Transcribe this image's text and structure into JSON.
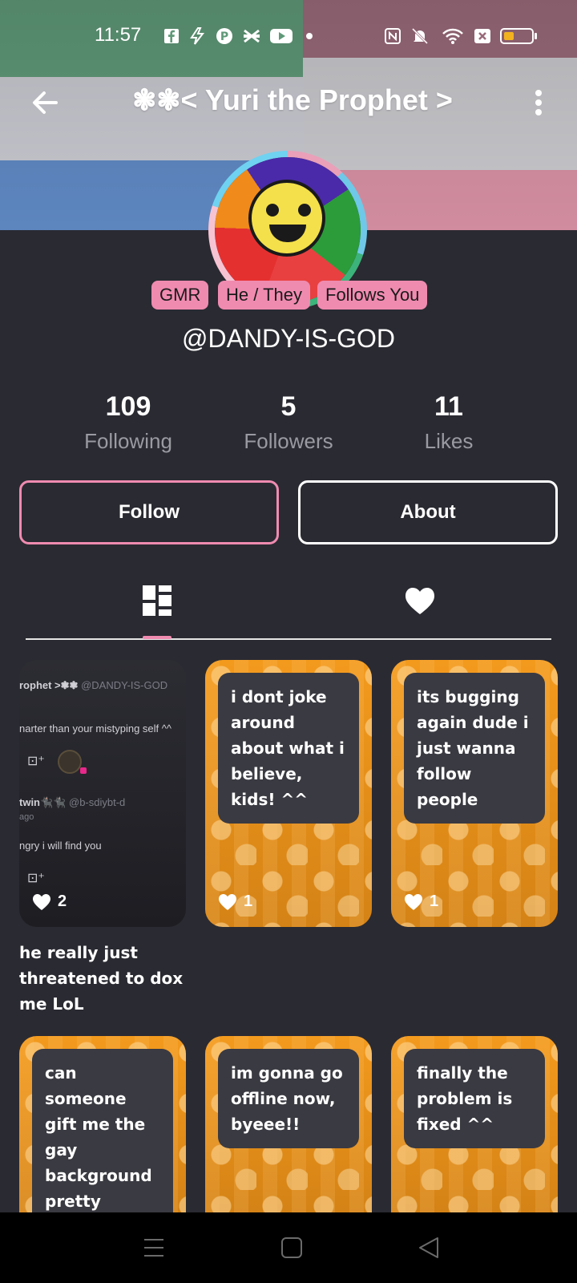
{
  "status_bar": {
    "time": "11:57",
    "battery_level": 0.35,
    "icons": [
      "facebook-icon",
      "bolt-icon",
      "pinterest-icon",
      "capcut-icon",
      "youtube-icon",
      "dot-icon",
      "nfc-icon",
      "mute-icon",
      "wifi-icon",
      "sim-x-icon",
      "battery-icon"
    ]
  },
  "header": {
    "title": "❃❃< Yuri the Prophet >",
    "back_icon": "arrow-left-icon",
    "menu_icon": "more-vert-icon"
  },
  "profile": {
    "badges": [
      "GMR",
      "He / They",
      "Follows You"
    ],
    "handle": "@DANDY-IS-GOD",
    "stats": [
      {
        "value": "109",
        "label": "Following"
      },
      {
        "value": "5",
        "label": "Followers"
      },
      {
        "value": "11",
        "label": "Likes"
      }
    ]
  },
  "actions": {
    "follow_label": "Follow",
    "about_label": "About"
  },
  "tabs": {
    "posts_icon": "grid-icon",
    "likes_icon": "heart-icon",
    "active": "posts"
  },
  "posts": [
    {
      "type": "screenshot",
      "lines": {
        "user": "rophet >❃❃",
        "user_handle": "@DANDY-IS-GOD",
        "msg1": "narter than your mistyping self ^^",
        "user2": "twin🐈‍⬛🐈‍⬛",
        "user2_handle": "@b-sdiybt-d",
        "ago": "ago",
        "msg2": "ngry i will find you"
      },
      "likes": "2",
      "caption": "he really just threatened to dox me LoL"
    },
    {
      "type": "text",
      "text": "i dont joke around about what i believe, kids! ^^",
      "likes": "1"
    },
    {
      "type": "text",
      "text": "its bugging again dude i just wanna follow people",
      "likes": "1"
    },
    {
      "type": "text",
      "text": "can someone gift me the gay background pretty please?",
      "likes": ""
    },
    {
      "type": "text",
      "text": "im gonna go offline now, byeee!!",
      "likes": ""
    },
    {
      "type": "text",
      "text": "finally the problem is fixed ^^",
      "likes": ""
    }
  ],
  "colors": {
    "background": "#2a2a32",
    "accent_pink": "#f08bb0",
    "card_orange": "#f39a1d"
  },
  "nav": {
    "recents_icon": "menu-lines-icon",
    "home_icon": "square-icon",
    "back_icon": "triangle-back-icon"
  }
}
